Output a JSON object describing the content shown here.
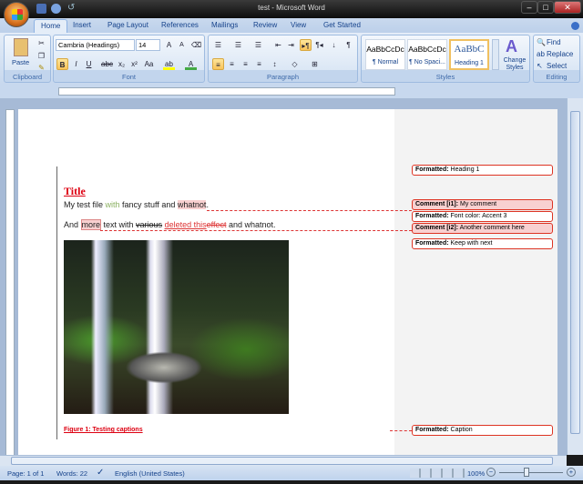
{
  "window": {
    "title": "test - Microsoft Word"
  },
  "tabs": [
    "Home",
    "Insert",
    "Page Layout",
    "References",
    "Mailings",
    "Review",
    "View",
    "Get Started"
  ],
  "ribbon": {
    "clipboard": {
      "label": "Clipboard",
      "paste": "Paste"
    },
    "font": {
      "label": "Font",
      "font_name": "Cambria (Headings)",
      "font_size": "14"
    },
    "paragraph": {
      "label": "Paragraph"
    },
    "styles": {
      "label": "Styles",
      "items": [
        {
          "preview": "AaBbCcDc",
          "name": "¶ Normal"
        },
        {
          "preview": "AaBbCcDc",
          "name": "¶ No Spaci..."
        },
        {
          "preview": "AaBbC",
          "name": "Heading 1"
        }
      ],
      "change_styles": "Change Styles"
    },
    "editing": {
      "label": "Editing",
      "find": "Find",
      "replace": "Replace",
      "select": "Select"
    }
  },
  "document": {
    "title": "Title",
    "line1": {
      "a": "My test file ",
      "inserted": "with",
      "b": " fancy stuff and ",
      "commented": "whatnot",
      "c": "."
    },
    "line2": {
      "a": "And ",
      "commented": "more",
      "b": " text with ",
      "deleted1": "various",
      "c": " ",
      "inserted": "deleted this",
      "deleted2": "effect",
      "d": " and whatnot."
    },
    "caption": "Figure 1: Testing captions"
  },
  "balloons": [
    {
      "kind": "Formatted:",
      "text": "Heading 1",
      "comment": false
    },
    {
      "kind": "Comment [i1]:",
      "text": "My comment",
      "comment": true
    },
    {
      "kind": "Formatted:",
      "text": "Font color: Accent 3",
      "comment": false
    },
    {
      "kind": "Comment [i2]:",
      "text": "Another comment here",
      "comment": true
    },
    {
      "kind": "Formatted:",
      "text": "Keep with next",
      "comment": false
    },
    {
      "kind": "Formatted:",
      "text": "Caption",
      "comment": false
    }
  ],
  "status": {
    "page": "Page: 1 of 1",
    "words": "Words: 22",
    "language": "English (United States)",
    "zoom": "100%"
  }
}
